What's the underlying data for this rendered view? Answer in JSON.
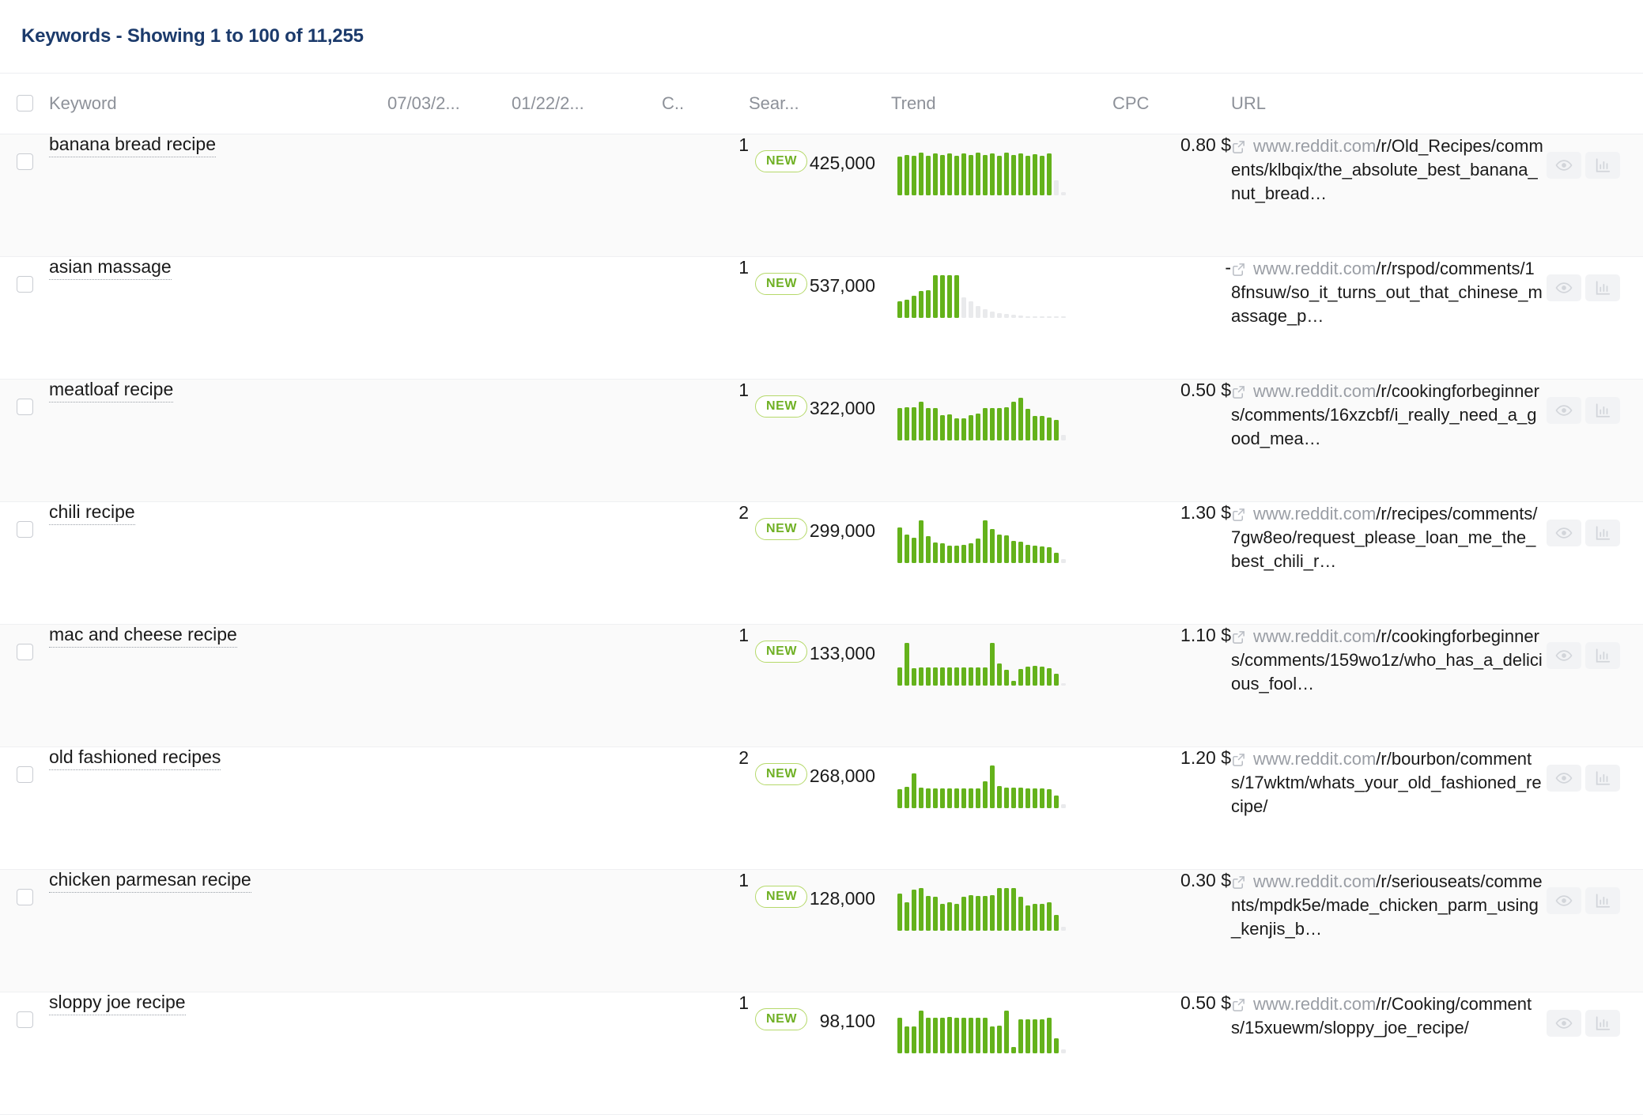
{
  "header": {
    "title": "Keywords - Showing 1 to 100 of 11,255"
  },
  "table": {
    "columns": [
      {
        "key": "select",
        "label": ""
      },
      {
        "key": "keyword",
        "label": "Keyword"
      },
      {
        "key": "date1",
        "label": "07/03/2..."
      },
      {
        "key": "date2",
        "label": "01/22/2..."
      },
      {
        "key": "c",
        "label": "C.."
      },
      {
        "key": "volume",
        "label": "Sear..."
      },
      {
        "key": "trend",
        "label": "Trend"
      },
      {
        "key": "cpc",
        "label": "CPC"
      },
      {
        "key": "url",
        "label": "URL"
      },
      {
        "key": "actions",
        "label": ""
      }
    ],
    "badge_label": "NEW",
    "colors": {
      "title": "#1b3a6b",
      "spark_active": "#64b21b",
      "spark_inactive": "#e9eaec",
      "badge_border": "#b5d96a",
      "badge_text": "#6fb024",
      "row_alt_bg": "#fafafa"
    },
    "rows": [
      {
        "keyword": "banana bread recipe",
        "c": "1",
        "badge": "NEW",
        "volume": "425,000",
        "cpc": "0.80 $",
        "url_domain": "www.reddit.com",
        "url_path": "/r/Old_Recipes/comments/klbqix/the_absolute_best_banana_nut_bread…",
        "trend": [
          78,
          82,
          80,
          86,
          80,
          84,
          81,
          85,
          80,
          84,
          82,
          86,
          81,
          84,
          80,
          86,
          82,
          85,
          80,
          83,
          80,
          84,
          30,
          6
        ],
        "trend_active": 22
      },
      {
        "keyword": "asian massage",
        "c": "1",
        "badge": "NEW",
        "volume": "537,000",
        "cpc": "-",
        "url_domain": "www.reddit.com",
        "url_path": "/r/rspod/comments/18fnsuw/so_it_turns_out_that_chinese_massage_p…",
        "trend": [
          34,
          38,
          46,
          55,
          57,
          88,
          88,
          88,
          88,
          42,
          34,
          25,
          18,
          13,
          10,
          8,
          6,
          5,
          4,
          4,
          4,
          4,
          4,
          4
        ],
        "trend_active": 9
      },
      {
        "keyword": "meatloaf recipe",
        "c": "1",
        "badge": "NEW",
        "volume": "322,000",
        "cpc": "0.50 $",
        "url_domain": "www.reddit.com",
        "url_path": "/r/cookingforbeginners/comments/16xzcbf/i_really_need_a_good_mea…",
        "trend": [
          70,
          72,
          71,
          84,
          70,
          70,
          55,
          56,
          48,
          48,
          55,
          58,
          70,
          70,
          70,
          72,
          84,
          92,
          68,
          52,
          53,
          50,
          44,
          12
        ],
        "trend_active": 23
      },
      {
        "keyword": "chili recipe",
        "c": "2",
        "badge": "NEW",
        "volume": "299,000",
        "cpc": "1.30 $",
        "url_domain": "www.reddit.com",
        "url_path": "/r/recipes/comments/7gw8eo/request_please_loan_me_the_best_chili_r…",
        "trend": [
          76,
          62,
          54,
          92,
          58,
          44,
          42,
          38,
          38,
          40,
          43,
          52,
          92,
          74,
          62,
          60,
          48,
          46,
          40,
          38,
          36,
          34,
          22,
          8
        ],
        "trend_active": 23
      },
      {
        "keyword": "mac and cheese recipe",
        "c": "1",
        "badge": "NEW",
        "volume": "133,000",
        "cpc": "1.10 $",
        "url_domain": "www.reddit.com",
        "url_path": "/r/cookingforbeginners/comments/159wo1z/who_has_a_delicious_fool…",
        "trend": [
          40,
          94,
          38,
          40,
          40,
          40,
          40,
          40,
          40,
          40,
          40,
          40,
          40,
          94,
          48,
          34,
          10,
          36,
          42,
          44,
          42,
          38,
          26,
          6
        ],
        "trend_active": 23
      },
      {
        "keyword": "old fashioned recipes",
        "c": "2",
        "badge": "NEW",
        "volume": "268,000",
        "cpc": "1.20 $",
        "url_domain": "www.reddit.com",
        "url_path": "/r/bourbon/comments/17wktm/whats_your_old_fashioned_recipe/",
        "trend": [
          42,
          48,
          78,
          46,
          44,
          44,
          44,
          44,
          44,
          44,
          44,
          44,
          60,
          96,
          50,
          46,
          46,
          46,
          44,
          44,
          44,
          42,
          28,
          8
        ],
        "trend_active": 23
      },
      {
        "keyword": "chicken parmesan recipe",
        "c": "1",
        "badge": "NEW",
        "volume": "128,000",
        "cpc": "0.30 $",
        "url_domain": "www.reddit.com",
        "url_path": "/r/seriouseats/comments/mpdk5e/made_chicken_parm_using_kenjis_b…",
        "trend": [
          76,
          58,
          84,
          88,
          72,
          70,
          56,
          58,
          56,
          70,
          74,
          72,
          72,
          74,
          88,
          88,
          88,
          70,
          52,
          56,
          56,
          58,
          32,
          8
        ],
        "trend_active": 23
      },
      {
        "keyword": "sloppy joe recipe",
        "c": "1",
        "badge": "NEW",
        "volume": "98,100",
        "cpc": "0.50 $",
        "url_domain": "www.reddit.com",
        "url_path": "/r/Cooking/comments/15xuewm/sloppy_joe_recipe/",
        "trend": [
          76,
          58,
          58,
          92,
          76,
          76,
          76,
          78,
          76,
          76,
          76,
          76,
          76,
          58,
          60,
          92,
          14,
          74,
          74,
          74,
          74,
          76,
          32,
          8
        ],
        "trend_active": 23
      }
    ]
  },
  "icons": {
    "external_link": "external-link-icon",
    "eye": "eye-icon",
    "chart": "bar-chart-icon"
  }
}
